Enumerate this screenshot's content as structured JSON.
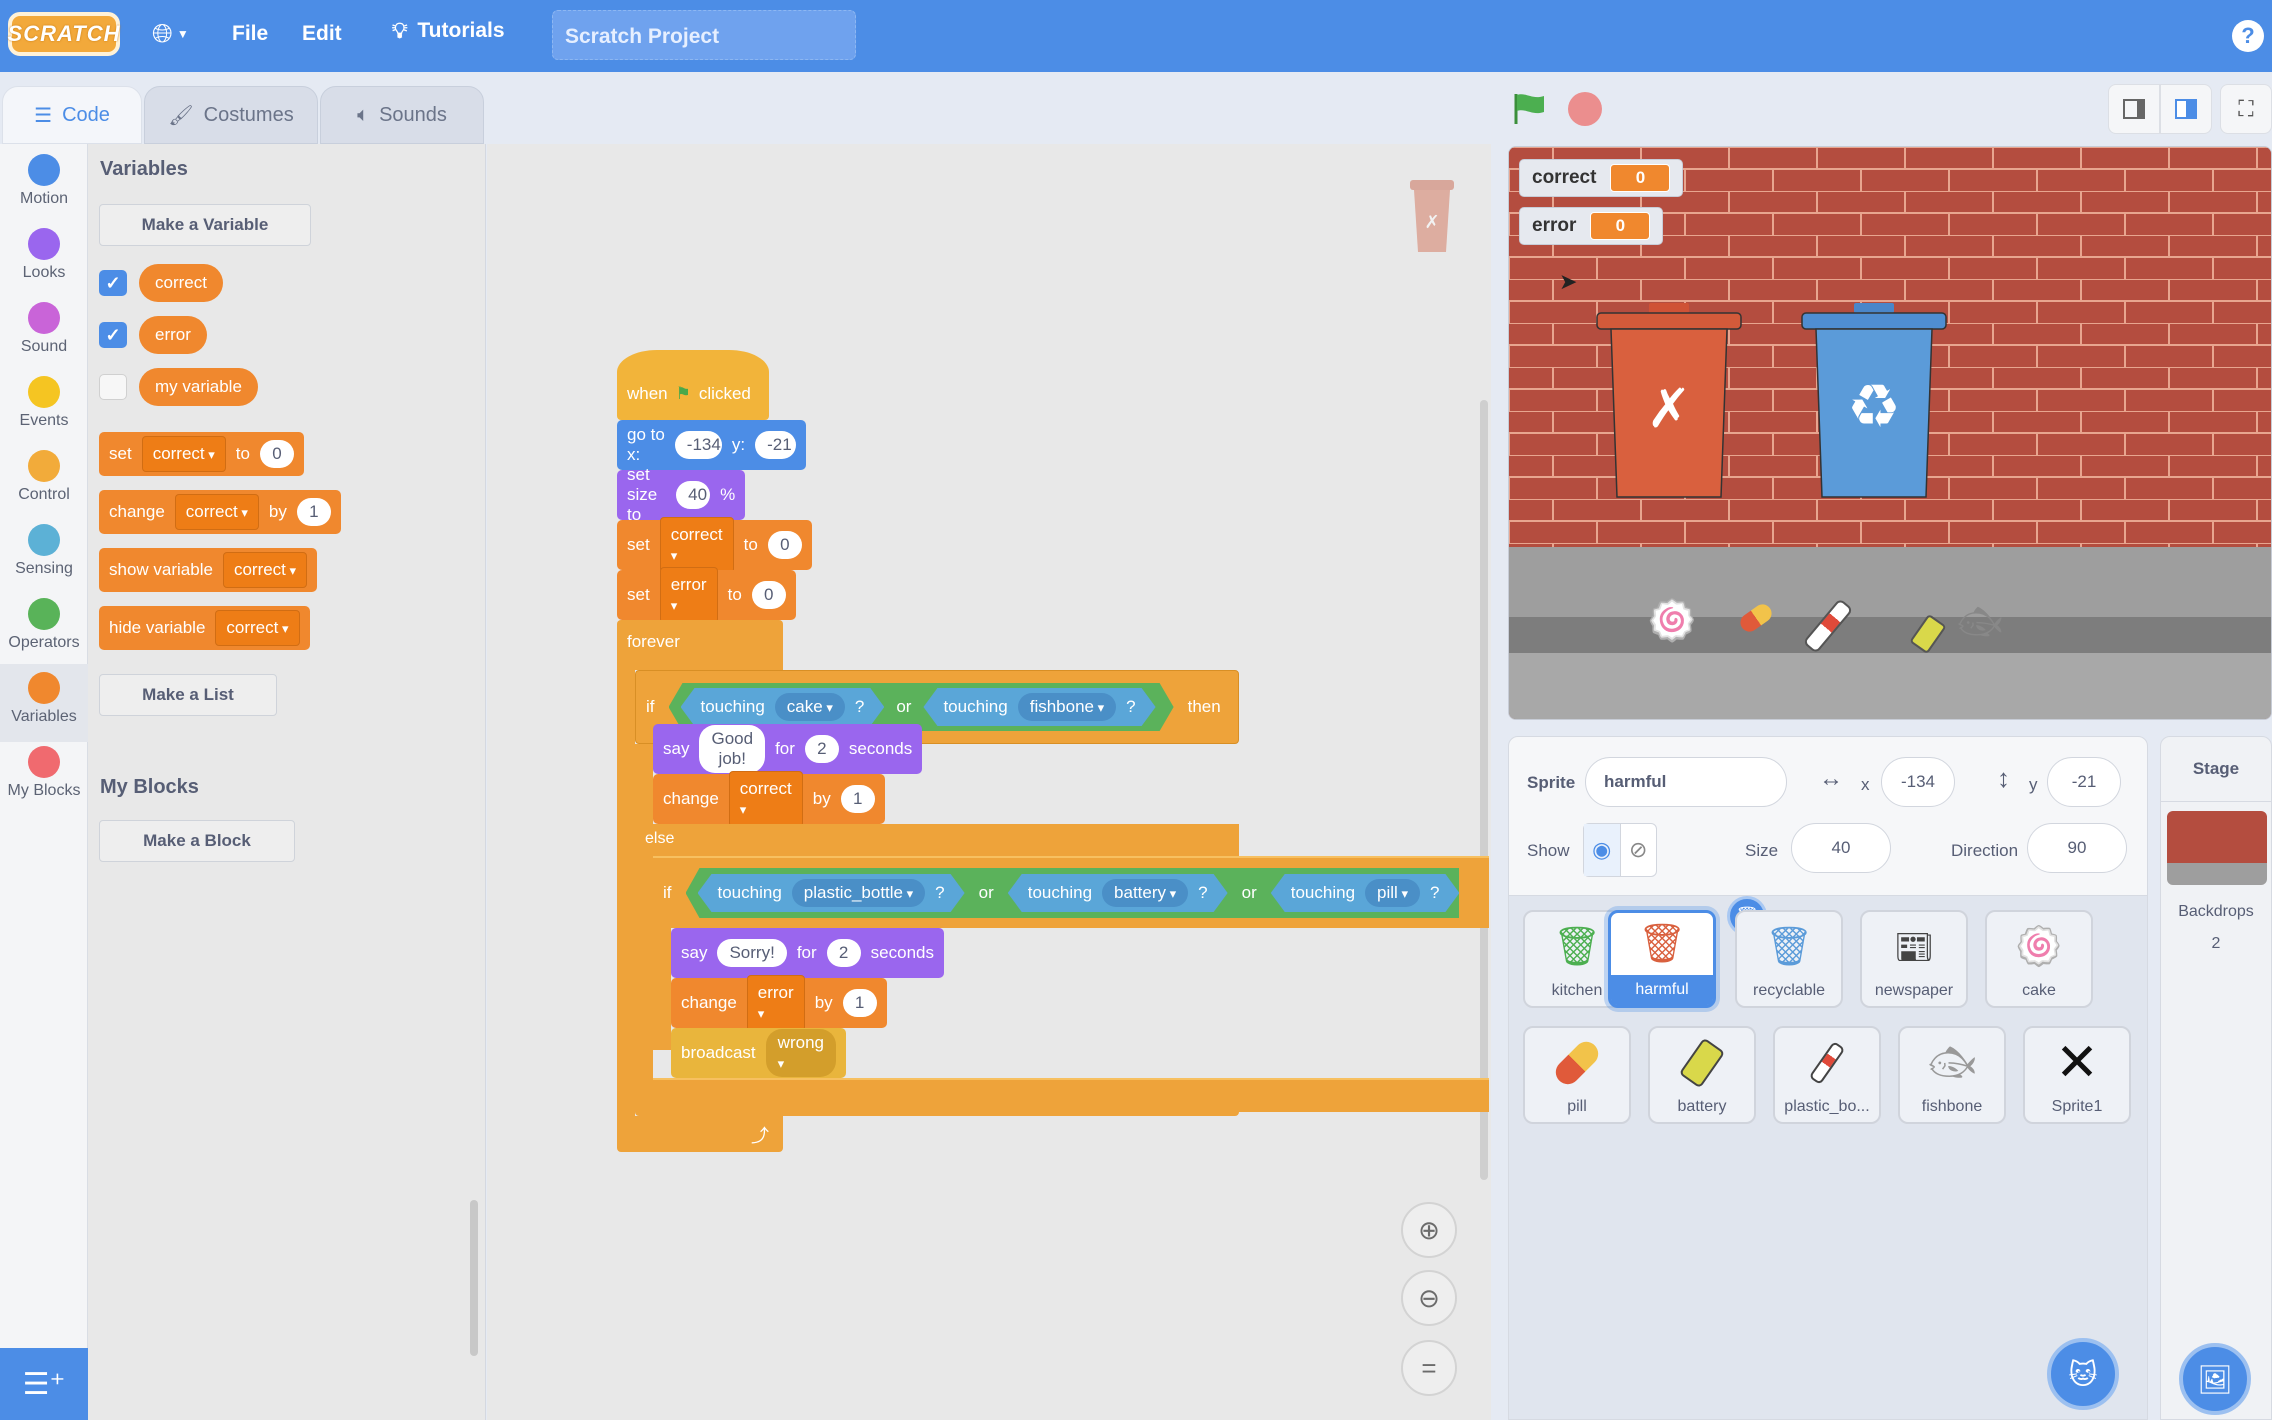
{
  "menubar": {
    "logo": "SCRATCH",
    "file": "File",
    "edit": "Edit",
    "tutorials": "Tutorials",
    "project_title": "Scratch Project",
    "help": "?"
  },
  "tabs": [
    {
      "label": "Code",
      "active": true
    },
    {
      "label": "Costumes",
      "active": false
    },
    {
      "label": "Sounds",
      "active": false
    }
  ],
  "categories": [
    {
      "label": "Motion",
      "color": "#4c8de6"
    },
    {
      "label": "Looks",
      "color": "#9a66ee"
    },
    {
      "label": "Sound",
      "color": "#c964d8"
    },
    {
      "label": "Events",
      "color": "#f5c522"
    },
    {
      "label": "Control",
      "color": "#f2ab3a"
    },
    {
      "label": "Sensing",
      "color": "#5cb1d6"
    },
    {
      "label": "Operators",
      "color": "#59b359"
    },
    {
      "label": "Variables",
      "color": "#f0882e"
    },
    {
      "label": "My Blocks",
      "color": "#f06a6f"
    }
  ],
  "palette": {
    "heading": "Variables",
    "make_variable": "Make a Variable",
    "variables": [
      {
        "name": "correct",
        "checked": true
      },
      {
        "name": "error",
        "checked": true
      },
      {
        "name": "my variable",
        "checked": false
      }
    ],
    "set_block": {
      "label": "set",
      "var": "correct",
      "to": "to",
      "value": "0"
    },
    "change_block": {
      "label": "change",
      "var": "correct",
      "by": "by",
      "value": "1"
    },
    "show_block": {
      "label": "show variable",
      "var": "correct"
    },
    "hide_block": {
      "label": "hide variable",
      "var": "correct"
    },
    "make_list": "Make a List",
    "myblocks_heading": "My Blocks",
    "make_block": "Make a Block"
  },
  "script": {
    "hat": {
      "when": "when",
      "clicked": "clicked"
    },
    "goto": {
      "label": "go to x:",
      "x": "-134",
      "ylabel": "y:",
      "y": "-21"
    },
    "setsize": {
      "label": "set size to",
      "value": "40",
      "unit": "%"
    },
    "set1": {
      "label": "set",
      "var": "correct",
      "to": "to",
      "value": "0"
    },
    "set2": {
      "label": "set",
      "var": "error",
      "to": "to",
      "value": "0"
    },
    "forever": "forever",
    "if1": {
      "if": "if",
      "then": "then",
      "or": "or",
      "cond1": {
        "touching": "touching",
        "target": "cake",
        "q": "?"
      },
      "cond2": {
        "touching": "touching",
        "target": "fishbone",
        "q": "?"
      }
    },
    "say1": {
      "say": "say",
      "text": "Good job!",
      "for": "for",
      "secs": "2",
      "seconds": "seconds"
    },
    "change1": {
      "label": "change",
      "var": "correct",
      "by": "by",
      "value": "1"
    },
    "else": "else",
    "if2": {
      "if": "if",
      "or": "or",
      "cond1": {
        "touching": "touching",
        "target": "plastic_bottle",
        "q": "?"
      },
      "cond2": {
        "touching": "touching",
        "target": "battery",
        "q": "?"
      },
      "cond3": {
        "touching": "touching",
        "target": "pill",
        "q": "?"
      }
    },
    "say2": {
      "say": "say",
      "text": "Sorry!",
      "for": "for",
      "secs": "2",
      "seconds": "seconds"
    },
    "change2": {
      "label": "change",
      "var": "error",
      "by": "by",
      "value": "1"
    },
    "broadcast": {
      "label": "broadcast",
      "message": "wrong"
    }
  },
  "stage": {
    "monitors": [
      {
        "name": "correct",
        "value": "0"
      },
      {
        "name": "error",
        "value": "0"
      }
    ]
  },
  "sprite_info": {
    "sprite_label": "Sprite",
    "sprite_name": "harmful",
    "x_label": "x",
    "x": "-134",
    "y_label": "y",
    "y": "-21",
    "show_label": "Show",
    "size_label": "Size",
    "size": "40",
    "direction_label": "Direction",
    "direction": "90"
  },
  "sprites": [
    {
      "name": "kitchen",
      "icon": "green-bin",
      "selected": false
    },
    {
      "name": "harmful",
      "icon": "red-bin",
      "selected": true
    },
    {
      "name": "recyclable",
      "icon": "blue-bin",
      "selected": false
    },
    {
      "name": "newspaper",
      "icon": "newspaper",
      "selected": false
    },
    {
      "name": "cake",
      "icon": "cake-roll",
      "selected": false
    },
    {
      "name": "pill",
      "icon": "pill",
      "selected": false
    },
    {
      "name": "battery",
      "icon": "battery",
      "selected": false
    },
    {
      "name": "plastic_bo...",
      "icon": "bottle",
      "selected": false
    },
    {
      "name": "fishbone",
      "icon": "fishbone",
      "selected": false
    },
    {
      "name": "Sprite1",
      "icon": "x-mark",
      "selected": false
    }
  ],
  "stage_pane": {
    "title": "Stage",
    "backdrops_label": "Backdrops",
    "backdrops_count": "2"
  }
}
